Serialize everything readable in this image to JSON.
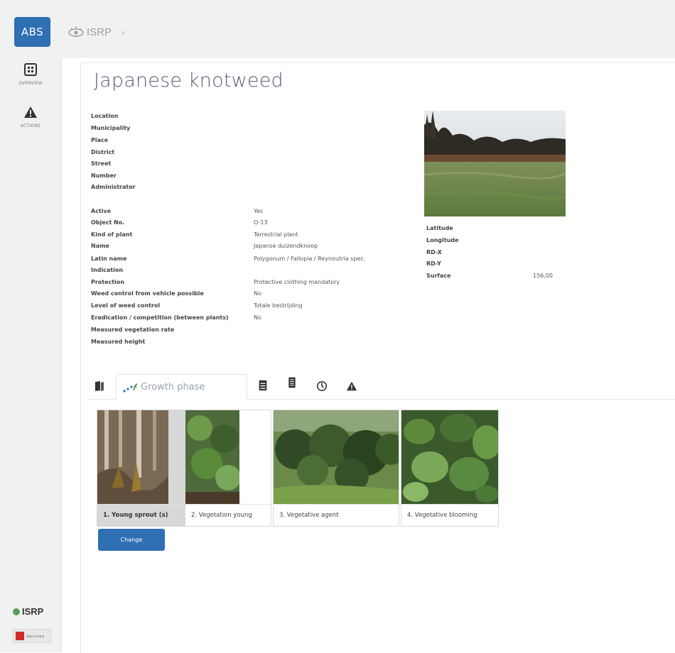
{
  "app": {
    "logo": "ABS",
    "accent": "#2f6fb4"
  },
  "breadcrumb": {
    "label": "ISRP",
    "separator": "›"
  },
  "sidebar": {
    "items": [
      {
        "icon": "overview-grid-icon",
        "label": "OVERVIEW"
      },
      {
        "icon": "warning-triangle-icon",
        "label": "ACTIONS"
      }
    ],
    "brand": {
      "name": "ISRP",
      "partner": "Data Control"
    }
  },
  "page": {
    "title": "Japanese knotweed"
  },
  "location_fields": [
    {
      "label": "Location",
      "value": ""
    },
    {
      "label": "Municipality",
      "value": ""
    },
    {
      "label": "Place",
      "value": ""
    },
    {
      "label": "District",
      "value": ""
    },
    {
      "label": "Street",
      "value": ""
    },
    {
      "label": "Number",
      "value": ""
    },
    {
      "label": "Administrator",
      "value": ""
    }
  ],
  "details": [
    {
      "label": "Active",
      "value": "Yes"
    },
    {
      "label": "Object No.",
      "value": "O-13"
    },
    {
      "label": "Kind of plant",
      "value": "Terrestrial plant"
    },
    {
      "label": "Name",
      "value": "Japanse duizendknoop"
    },
    {
      "label": "Latin name",
      "value": "Polygonum / Fallopia / Reynoutria spec."
    },
    {
      "label": "Indication",
      "value": ""
    },
    {
      "label": "Protection",
      "value": "Protective clothing mandatory"
    },
    {
      "label": "Weed control from vehicle possible",
      "value": "No"
    },
    {
      "label": "Level of weed control",
      "value": "Totale bestrijding"
    },
    {
      "label": "Eradication / competition (between plants)",
      "value": "No"
    },
    {
      "label": "Measured vegetation rate",
      "value": ""
    },
    {
      "label": "Measured height",
      "value": ""
    }
  ],
  "geo": [
    {
      "label": "Latitude",
      "value": ""
    },
    {
      "label": "Longitude",
      "value": ""
    },
    {
      "label": "RD-X",
      "value": ""
    },
    {
      "label": "RD-Y",
      "value": ""
    },
    {
      "label": "Surface",
      "value": "156,00"
    }
  ],
  "tabs": [
    {
      "icon": "book-icon",
      "label": ""
    },
    {
      "icon": "growth-icon",
      "label": "Growth phase"
    },
    {
      "icon": "document-icon",
      "label": ""
    },
    {
      "icon": "report-icon",
      "label": ""
    },
    {
      "icon": "clock-icon",
      "label": ""
    },
    {
      "icon": "warning-icon",
      "label": ""
    }
  ],
  "phases": [
    {
      "label": "1. Young sprout (s)",
      "selected": true
    },
    {
      "label": "2. Vegetation young",
      "selected": false
    },
    {
      "label": "3. Vegetative agent",
      "selected": false
    },
    {
      "label": "4. Vegetative blooming",
      "selected": false
    }
  ],
  "actions": {
    "change_label": "Change"
  }
}
